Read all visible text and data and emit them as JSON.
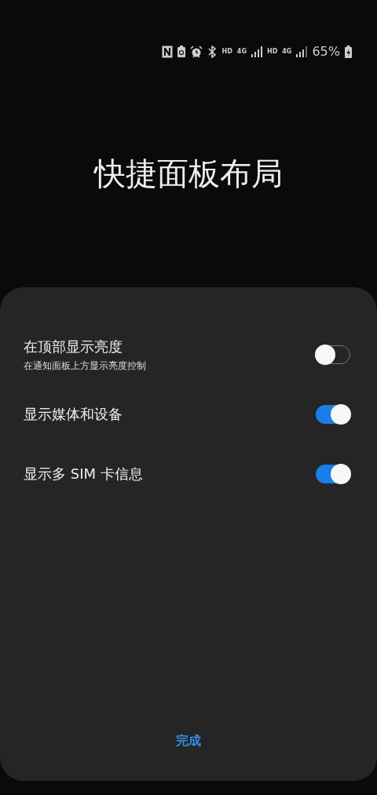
{
  "status_bar": {
    "network_labels": [
      "HD",
      "4G",
      "HD",
      "4G"
    ],
    "battery": "65%"
  },
  "title": "快捷面板布局",
  "settings": [
    {
      "label": "在顶部显示亮度",
      "description": "在通知面板上方显示亮度控制",
      "on": false
    },
    {
      "label": "显示媒体和设备",
      "on": true
    },
    {
      "label": "显示多 SIM 卡信息",
      "on": true
    }
  ],
  "done_button": "完成"
}
